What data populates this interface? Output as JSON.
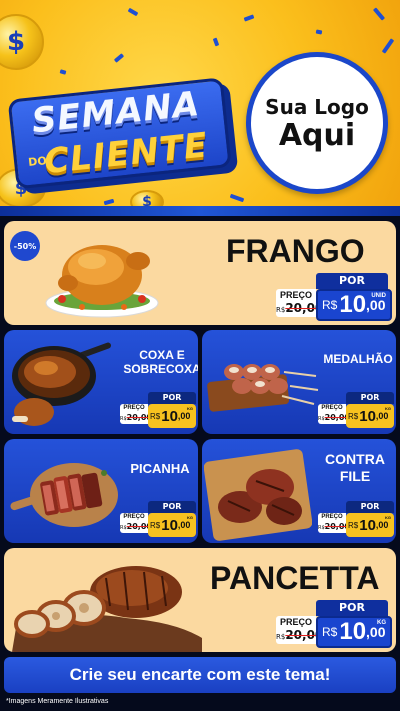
{
  "header": {
    "title_line1": "SEMANA",
    "title_do": "DO",
    "title_line2": "CLIENTE",
    "logo_line1": "Sua Logo",
    "logo_line2": "Aqui",
    "coin_symbol": "$"
  },
  "products": [
    {
      "name": "FRANGO",
      "badge": "-50%",
      "por": "POR",
      "preco_label": "PREÇO",
      "old_currency": "R$",
      "old_price": "20,00",
      "currency": "R$",
      "price_int": "10",
      "price_dec": ",00",
      "unit": "UNID"
    },
    {
      "name_line1": "COXA E",
      "name_line2": "SOBRECOXA",
      "por": "POR",
      "preco_label": "PREÇO",
      "old_currency": "R$",
      "old_price": "20,00",
      "currency": "R$",
      "price_int": "10",
      "price_dec": ",00",
      "unit": "KG"
    },
    {
      "name": "MEDALHÃO",
      "por": "POR",
      "preco_label": "PREÇO",
      "old_currency": "R$",
      "old_price": "20,00",
      "currency": "R$",
      "price_int": "10",
      "price_dec": ",00",
      "unit": "KG"
    },
    {
      "name": "PICANHA",
      "por": "POR",
      "preco_label": "PREÇO",
      "old_currency": "R$",
      "old_price": "20,00",
      "currency": "R$",
      "price_int": "10",
      "price_dec": ",00",
      "unit": "KG"
    },
    {
      "name_line1": "CONTRA",
      "name_line2": "FILE",
      "por": "POR",
      "preco_label": "PREÇO",
      "old_currency": "R$",
      "old_price": "20,00",
      "currency": "R$",
      "price_int": "10",
      "price_dec": ",00",
      "unit": "KG"
    },
    {
      "name": "PANCETTA",
      "por": "POR",
      "preco_label": "PREÇO",
      "old_currency": "R$",
      "old_price": "20,00",
      "currency": "R$",
      "price_int": "10",
      "price_dec": ",00",
      "unit": "KG"
    }
  ],
  "footer": {
    "cta": "Crie seu encarte com este tema!",
    "disclaimer": "*Imagens Meramente Ilustrativas"
  },
  "colors": {
    "header_yellow": "#fbbf1c",
    "brand_blue": "#1f48cf",
    "card_light": "#fbd9a0",
    "price_yellow": "#f7c21f",
    "page_dark": "#050a1c"
  },
  "icons": [
    "coin-icon",
    "roast-chicken-image",
    "chicken-thigh-pan-image",
    "medallion-skewers-image",
    "picanha-board-image",
    "steaks-board-image",
    "pancetta-roast-image"
  ]
}
